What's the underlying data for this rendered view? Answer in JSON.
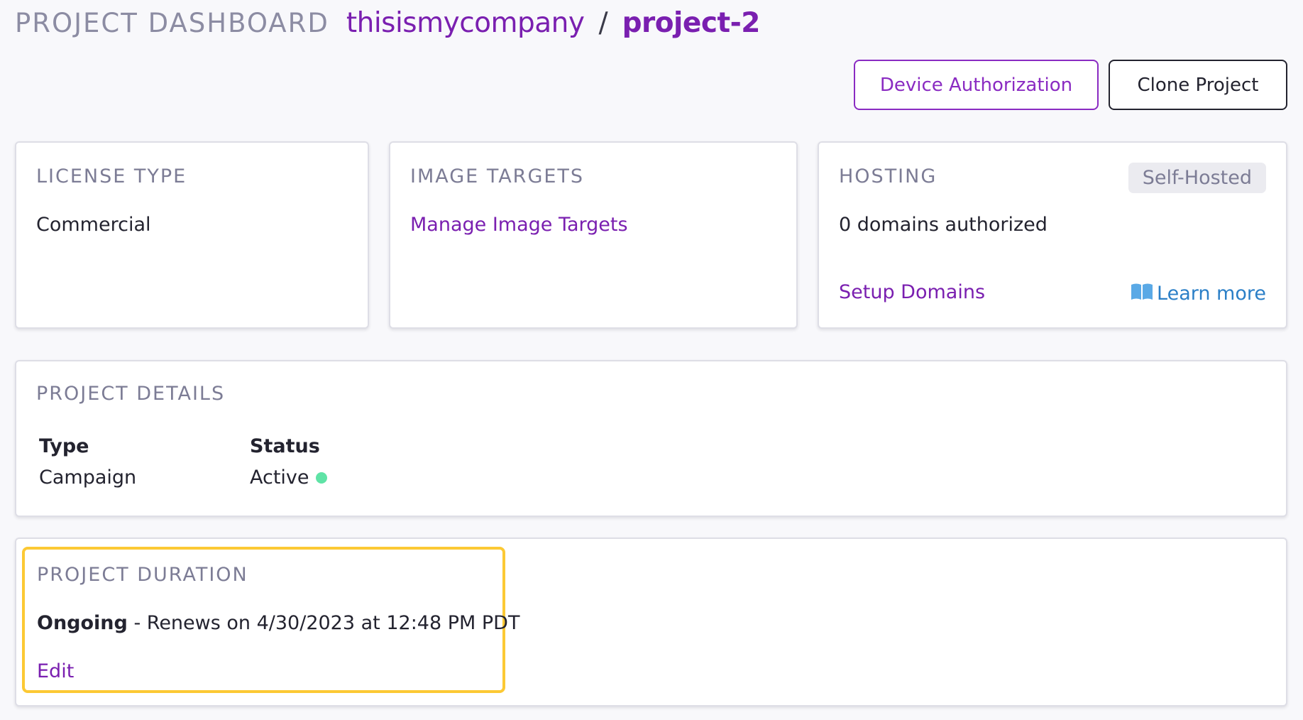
{
  "header": {
    "title": "PROJECT DASHBOARD",
    "company": "thisismycompany",
    "separator": "/",
    "project": "project-2"
  },
  "actions": {
    "device_authorization": "Device Authorization",
    "clone_project": "Clone Project"
  },
  "license": {
    "label": "LICENSE TYPE",
    "value": "Commercial"
  },
  "image_targets": {
    "label": "IMAGE TARGETS",
    "manage_link": "Manage Image Targets"
  },
  "hosting": {
    "label": "HOSTING",
    "badge": "Self-Hosted",
    "domains": "0 domains authorized",
    "setup_link": "Setup Domains",
    "learn_more": "Learn more",
    "learn_more_icon": "book-icon"
  },
  "details": {
    "label": "PROJECT DETAILS",
    "columns": [
      {
        "header": "Type",
        "value": "Campaign"
      },
      {
        "header": "Status",
        "value": "Active"
      }
    ],
    "status_color": "#5fe3a6"
  },
  "duration": {
    "label": "PROJECT DURATION",
    "state": "Ongoing",
    "renewal": " - Renews on 4/30/2023 at 12:48 PM PDT",
    "edit_link": "Edit",
    "highlight_color": "#fcc934"
  },
  "colors": {
    "accent": "#7a1fb0",
    "link_blue": "#2b7fc7",
    "muted": "#7c7c95"
  }
}
